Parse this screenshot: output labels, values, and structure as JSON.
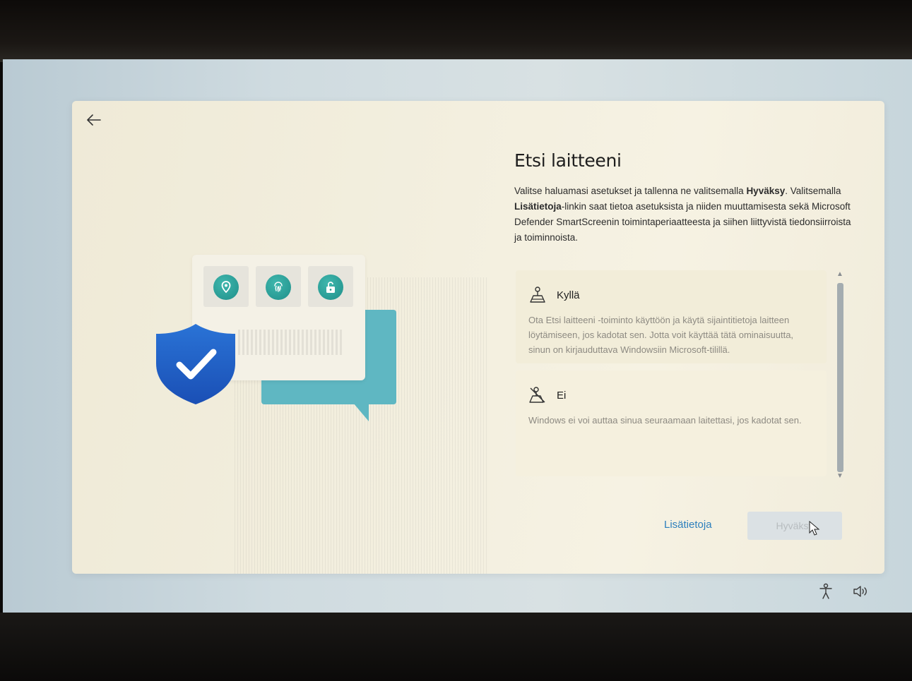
{
  "header": {
    "title": "Etsi laitteeni"
  },
  "description": {
    "part1": "Valitse haluamasi asetukset ja tallenna ne valitsemalla ",
    "bold1": "Hyväksy",
    "part2": ". Valitsemalla ",
    "bold2": "Lisätietoja",
    "part3": "-linkin saat tietoa asetuksista ja niiden muuttamisesta sekä Microsoft Defender SmartScreenin toimintaperiaatteesta ja siihen liittyvistä tiedonsiirroista ja toiminnoista."
  },
  "options": [
    {
      "label": "Kyllä",
      "icon": "location-person-icon",
      "description": "Ota Etsi laitteeni -toiminto käyttöön ja käytä sijaintitietoja laitteen löytämiseen, jos kadotat sen. Jotta voit käyttää tätä ominaisuutta, sinun on kirjauduttava Windowsiin Microsoft-tilillä."
    },
    {
      "label": "Ei",
      "icon": "location-off-icon",
      "description": "Windows ei voi auttaa sinua seuraamaan laitettasi, jos kadotat sen."
    }
  ],
  "footer": {
    "learn_more": "Lisätietoja",
    "accept": "Hyväksy"
  },
  "colors": {
    "accent": "#2c7fbd",
    "shield": "#2266c9",
    "teal": "#5fb7c2"
  },
  "icons": [
    "back-arrow-icon",
    "location-pin-icon",
    "fingerprint-icon",
    "padlock-icon",
    "shield-check-icon",
    "accessibility-icon",
    "volume-icon"
  ]
}
